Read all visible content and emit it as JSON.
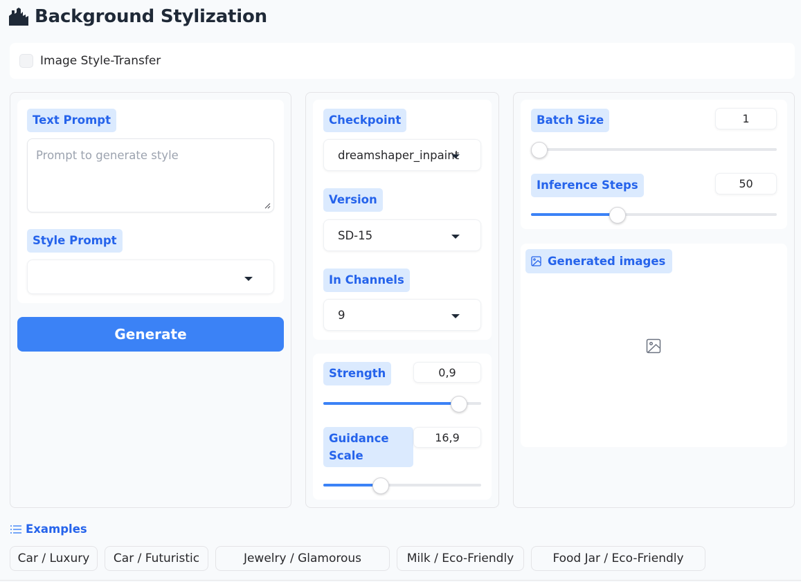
{
  "app": {
    "title": "Background Stylization",
    "logo_icon": "buildings-icon"
  },
  "style_transfer": {
    "label": "Image Style-Transfer",
    "checked": false
  },
  "left": {
    "text_prompt": {
      "label": "Text Prompt",
      "placeholder": "Prompt to generate style",
      "value": ""
    },
    "style_prompt": {
      "label": "Style Prompt",
      "value": ""
    },
    "generate_label": "Generate"
  },
  "middle": {
    "checkpoint": {
      "label": "Checkpoint",
      "value": "dreamshaper_inpaint"
    },
    "version": {
      "label": "Version",
      "value": "SD-15"
    },
    "in_channels": {
      "label": "In Channels",
      "value": "9"
    },
    "strength": {
      "label": "Strength",
      "value": "0,9",
      "fraction": 0.9
    },
    "guidance": {
      "label": "Guidance Scale",
      "value": "16,9",
      "fraction": 0.35
    }
  },
  "right": {
    "batch_size": {
      "label": "Batch Size",
      "value": "1",
      "fraction": 0.0
    },
    "inference_steps": {
      "label": "Inference Steps",
      "value": "50",
      "fraction": 0.34
    },
    "gallery": {
      "label": "Generated images",
      "icon": "image-icon"
    }
  },
  "examples": {
    "label": "Examples",
    "items": [
      "Car / Luxury",
      "Car / Futuristic",
      "Jewelry / Glamorous",
      "Milk / Eco-Friendly",
      "Food Jar / Eco-Friendly"
    ]
  },
  "colors": {
    "accent": "#3b82f6",
    "label_bg": "#dbeafe",
    "label_text": "#2563eb"
  }
}
